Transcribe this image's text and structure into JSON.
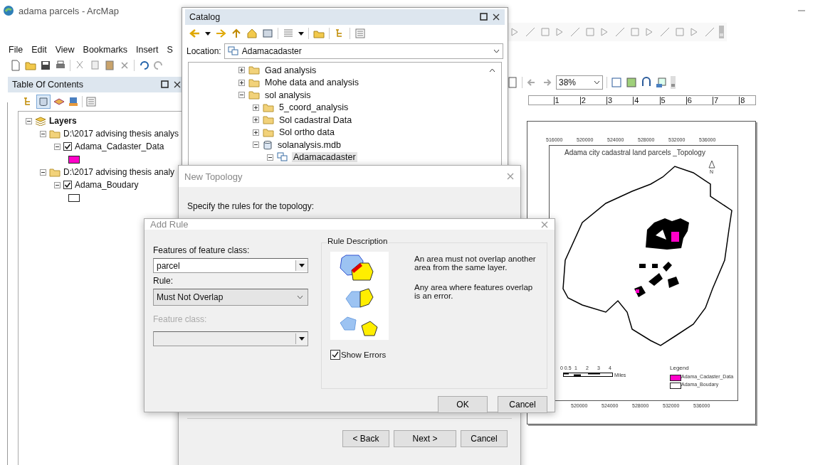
{
  "window": {
    "title": "adama parcels - ArcMap"
  },
  "menu": [
    "File",
    "Edit",
    "View",
    "Bookmarks",
    "Insert",
    "S"
  ],
  "toc": {
    "title": "Table Of Contents",
    "tree": [
      {
        "kind": "group",
        "label": "Layers",
        "expanded": true,
        "children": [
          {
            "kind": "folder",
            "label": "D:\\2017 advising thesis analys",
            "expanded": true,
            "children": [
              {
                "kind": "layer",
                "label": "Adama_Cadaster_Data",
                "checked": true,
                "expanded": true,
                "color": "#ff00c8"
              }
            ]
          },
          {
            "kind": "folder",
            "label": "D:\\2017 advising thesis analy",
            "expanded": true,
            "children": [
              {
                "kind": "layer",
                "label": "Adama_Boudary",
                "checked": true,
                "expanded": true,
                "color": "#ffffff"
              }
            ]
          }
        ]
      }
    ]
  },
  "layout_toolbar": {
    "zoom": "38%"
  },
  "ruler": [
    "1",
    "2",
    "3",
    "4",
    "5",
    "6",
    "7",
    "8"
  ],
  "map": {
    "title": "Adama city cadastral land parcels _Topology",
    "north": "N",
    "top_ticks": [
      "516000",
      "520000",
      "524000",
      "528000",
      "532000",
      "536000"
    ],
    "bottom_ticks": [
      "520000",
      "524000",
      "528000",
      "532000",
      "536000"
    ],
    "scale_labels": [
      "0 0.5",
      "1",
      "2",
      "3",
      "4"
    ],
    "scale_unit": "Miles",
    "legend": {
      "title": "Legend",
      "items": [
        {
          "label": "Adama_Cadaster_Data",
          "color": "#ff00c8"
        },
        {
          "label": "Adama_Boudary",
          "color": "#ffffff"
        }
      ]
    }
  },
  "catalog": {
    "title": "Catalog",
    "location_label": "Location:",
    "location": "Adamacadaster",
    "tree": [
      {
        "kind": "folder",
        "label": "Gad analysis",
        "expanded": false,
        "selected": false
      },
      {
        "kind": "folder",
        "label": "Mohe data and analysis",
        "expanded": false,
        "selected": false
      },
      {
        "kind": "folder",
        "label": "sol analysis",
        "expanded": true,
        "selected": false,
        "children": [
          {
            "kind": "folder",
            "label": "5_coord_analysis",
            "expanded": false,
            "selected": false
          },
          {
            "kind": "folder",
            "label": "Sol cadastral Data",
            "expanded": false,
            "selected": false
          },
          {
            "kind": "folder",
            "label": "Sol ortho data",
            "expanded": false,
            "selected": false
          },
          {
            "kind": "database",
            "label": "solanalysis.mdb",
            "expanded": true,
            "selected": false,
            "children": [
              {
                "kind": "dataset",
                "label": "Adamacadaster",
                "expanded": true,
                "selected": true
              }
            ]
          }
        ]
      }
    ]
  },
  "new_topology": {
    "title": "New Topology",
    "prompt": "Specify the rules for the topology:",
    "buttons": [
      "< Back",
      "Next >",
      "Cancel"
    ]
  },
  "add_rule": {
    "title": "Add Rule",
    "features_label": "Features of feature class:",
    "features_value": "parcel",
    "rule_label": "Rule:",
    "rule_value": "Must Not Overlap",
    "feature_class_label": "Feature class:",
    "feature_class_disabled": true,
    "description_title": "Rule Description",
    "description": [
      "An area must not overlap another area from the same layer.",
      "Any area where features overlap is an error."
    ],
    "show_errors": {
      "label": "Show Errors",
      "checked": true
    },
    "buttons": [
      "OK",
      "Cancel"
    ]
  }
}
